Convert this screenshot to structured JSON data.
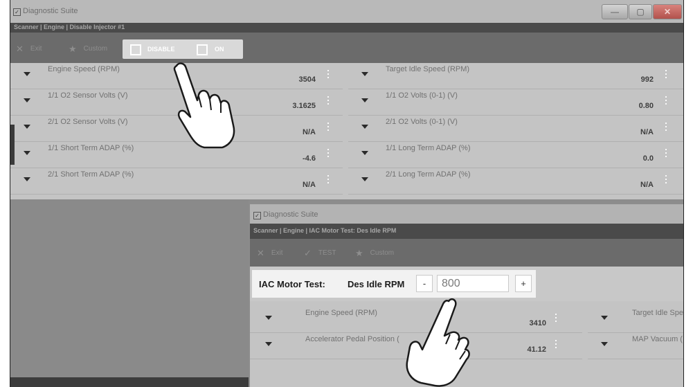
{
  "window1": {
    "title": "Diagnostic Suite",
    "breadcrumb": "Scanner | Engine | Disable Injector #1",
    "toolbar": {
      "exit_label": "Exit",
      "custom_label": "Custom",
      "disable_label": "DISABLE",
      "on_label": "ON"
    },
    "controls": {
      "minimize": "—",
      "maximize": "▢",
      "close": "✕"
    },
    "pids": [
      {
        "name": "Engine Speed (RPM)",
        "value": "3504"
      },
      {
        "name": "Target Idle Speed (RPM)",
        "value": "992"
      },
      {
        "name": "1/1 O2 Sensor Volts (V)",
        "value": "3.1625"
      },
      {
        "name": "1/1 O2 Volts (0-1) (V)",
        "value": "0.80"
      },
      {
        "name": "2/1 O2 Sensor Volts (V)",
        "value": "N/A"
      },
      {
        "name": "2/1 O2 Volts (0-1) (V)",
        "value": "N/A"
      },
      {
        "name": "1/1 Short Term ADAP (%)",
        "value": "-4.6"
      },
      {
        "name": "1/1 Long Term ADAP (%)",
        "value": "0.0"
      },
      {
        "name": "2/1 Short Term ADAP (%)",
        "value": "N/A"
      },
      {
        "name": "2/1 Long Term ADAP (%)",
        "value": "N/A"
      }
    ]
  },
  "window2": {
    "title": "Diagnostic Suite",
    "breadcrumb": "Scanner | Engine | IAC Motor Test:   Des Idle RPM",
    "toolbar": {
      "exit_label": "Exit",
      "test_label": "TEST",
      "custom_label": "Custom"
    },
    "control": {
      "test_label": "IAC Motor Test:",
      "param_label": "Des Idle RPM",
      "minus": "-",
      "plus": "+",
      "value": "800"
    },
    "pids": [
      {
        "name": "Engine Speed (RPM)",
        "value": "3410"
      },
      {
        "name": "Target Idle Spee",
        "value": ""
      },
      {
        "name": "Accelerator Pedal Position (",
        "value": "41.12"
      },
      {
        "name": "MAP Vacuum (",
        "value": ""
      }
    ]
  },
  "icons": [
    "checkbox-icon",
    "close-icon",
    "star-icon",
    "check-icon",
    "dropdown-arrow-icon",
    "kebab-menu-icon",
    "pointing-hand-icon"
  ]
}
